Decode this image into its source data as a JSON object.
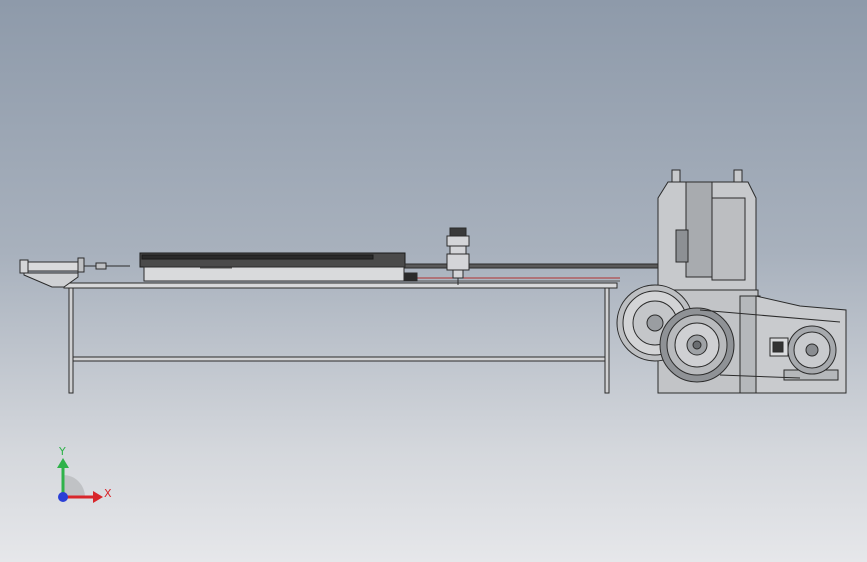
{
  "viewport": {
    "background_top": "#8e9aaa",
    "background_bottom": "#e6e7ea"
  },
  "model": {
    "line_color": "#2b2b2b",
    "metal_color": "#b9bcc0",
    "dark_metal": "#3a3a3a",
    "accent_red": "#c0392b"
  },
  "triad": {
    "x_label": "X",
    "y_label": "Y",
    "x_color": "#d8262b",
    "y_color": "#2fb24a",
    "z_color": "#2a3fd6"
  }
}
